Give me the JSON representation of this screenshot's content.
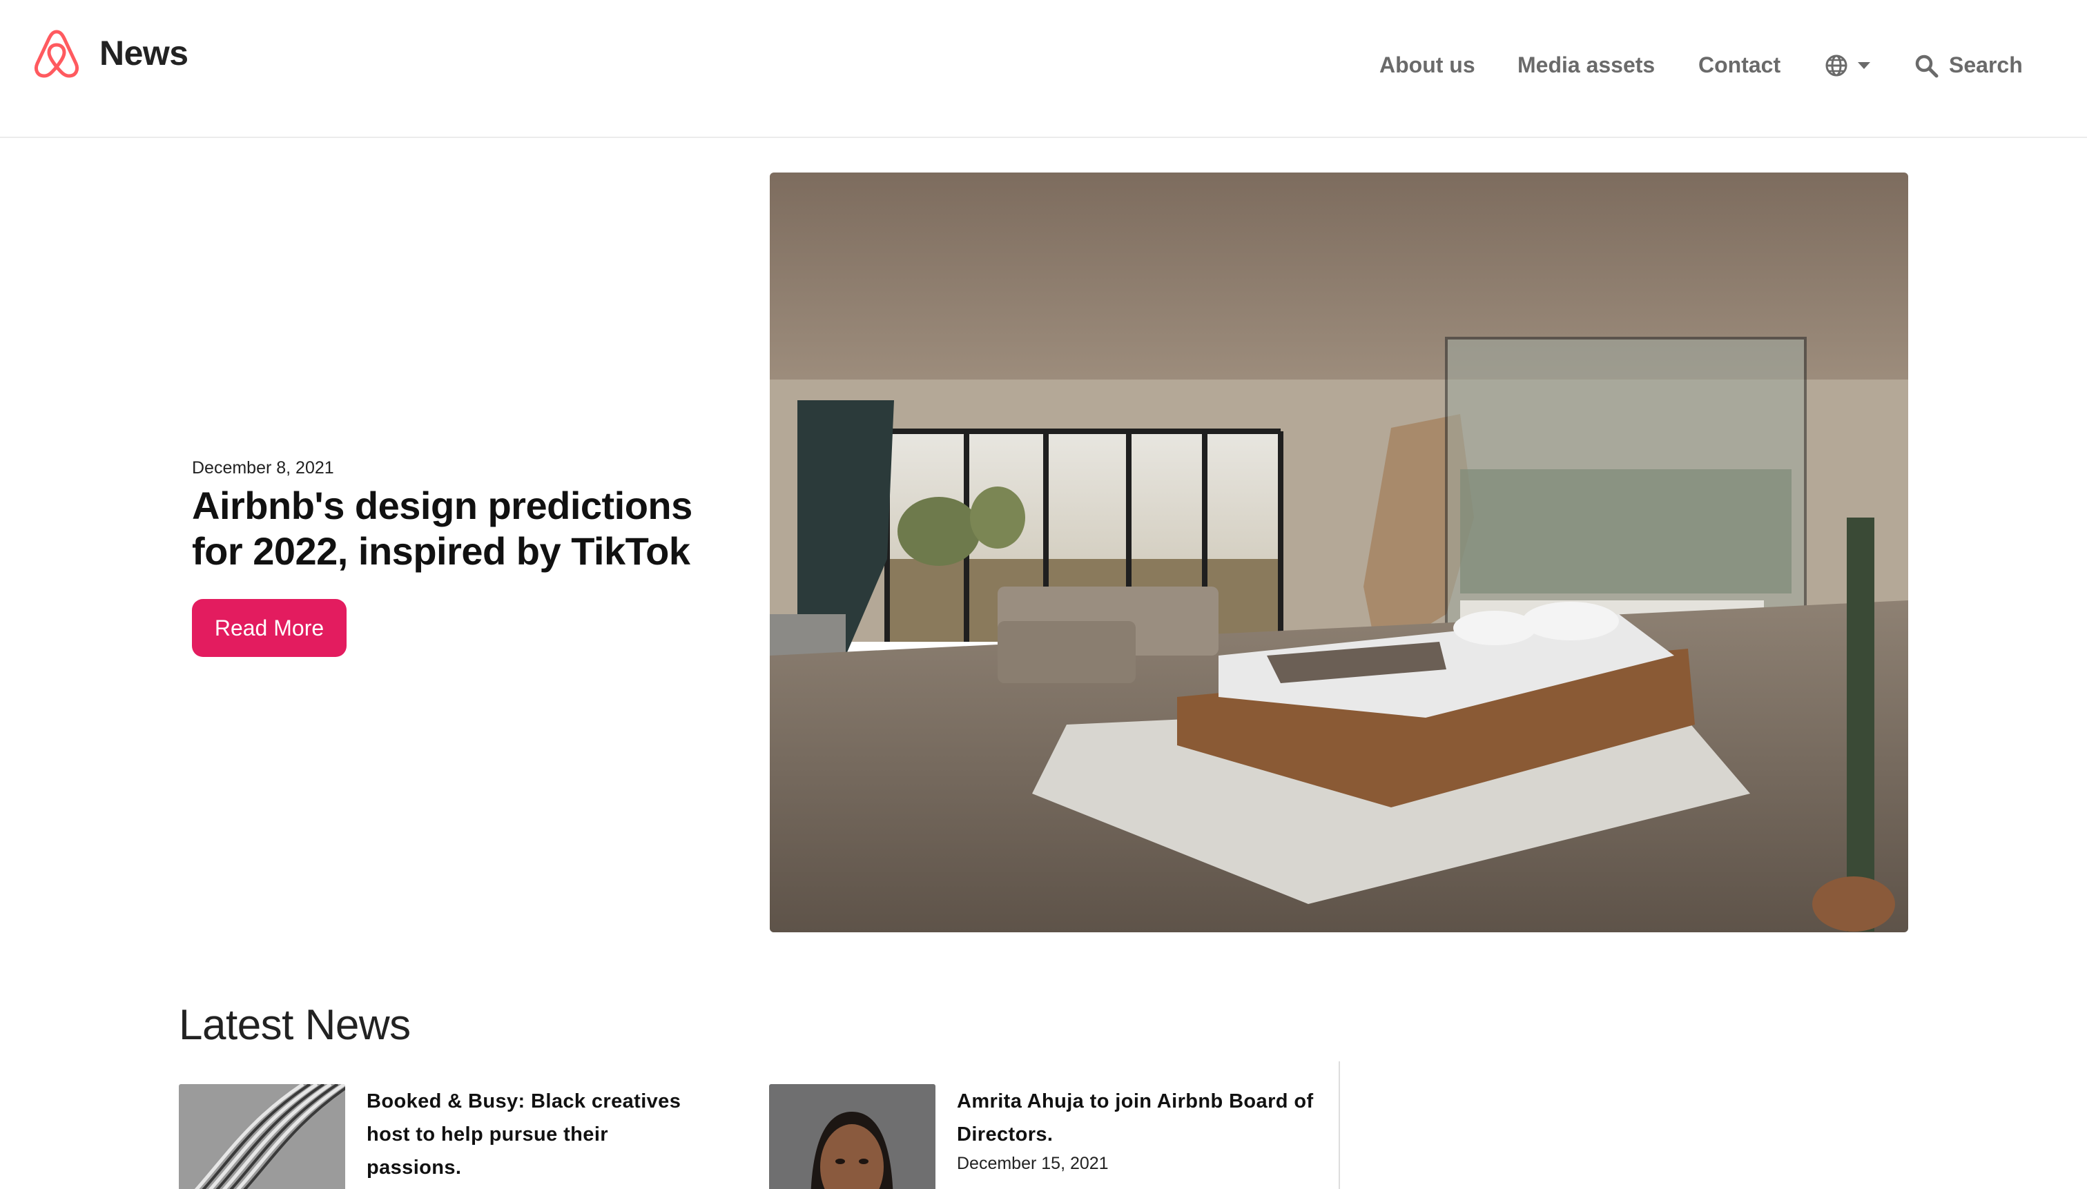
{
  "header": {
    "brand": "News",
    "nav": {
      "about": "About us",
      "media": "Media assets",
      "contact": "Contact",
      "search": "Search"
    },
    "icons": [
      "airbnb-logo",
      "globe-icon",
      "chevron-down-icon",
      "search-icon"
    ]
  },
  "hero": {
    "date": "December 8, 2021",
    "title": "Airbnb's design predictions for 2022, inspired by TikTok",
    "button": "Read More"
  },
  "latest": {
    "title": "Latest News",
    "items": [
      {
        "title": "Booked & Busy: Black creatives host to help pursue their passions.",
        "date": ""
      },
      {
        "title": "Amrita Ahuja to join Airbnb Board of Directors.",
        "date": "December 15, 2021"
      }
    ]
  },
  "colors": {
    "brand": "#FF5A5F",
    "button": "#E31C5F",
    "nav_text": "#6A6A6A"
  }
}
